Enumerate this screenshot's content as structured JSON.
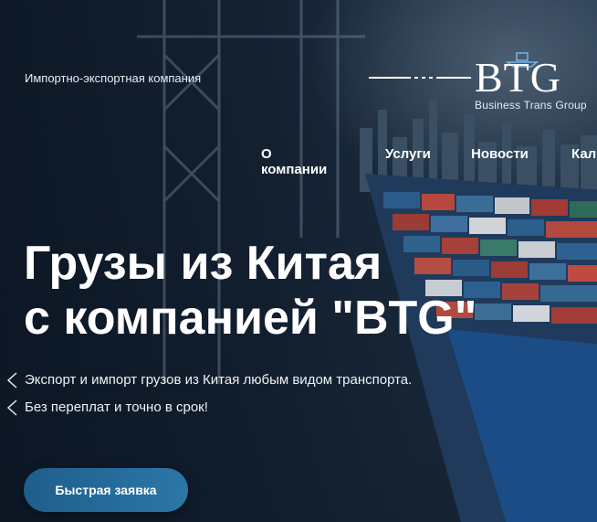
{
  "header": {
    "tagline": "Импортно-экспортная компания",
    "logo": {
      "mark": "BTG",
      "subtitle": "Business Trans Group"
    }
  },
  "nav": {
    "items": [
      {
        "label": "О компании"
      },
      {
        "label": "Услуги"
      },
      {
        "label": "Новости"
      },
      {
        "label": "Кал"
      }
    ]
  },
  "hero": {
    "headline_line1": "Грузы из Китая",
    "headline_line2": "с компанией \"BTG\"",
    "bullets": [
      "Экспорт и импорт грузов из Китая любым видом транспорта.",
      "Без переплат и точно в срок!"
    ],
    "cta_label": "Быстрая заявка"
  },
  "icons": {
    "bullet": "chevron-left-icon",
    "logo": "ship-logo-icon"
  },
  "colors": {
    "cta_start": "#1f5e8c",
    "cta_end": "#2b77a8",
    "text": "#ffffff"
  }
}
